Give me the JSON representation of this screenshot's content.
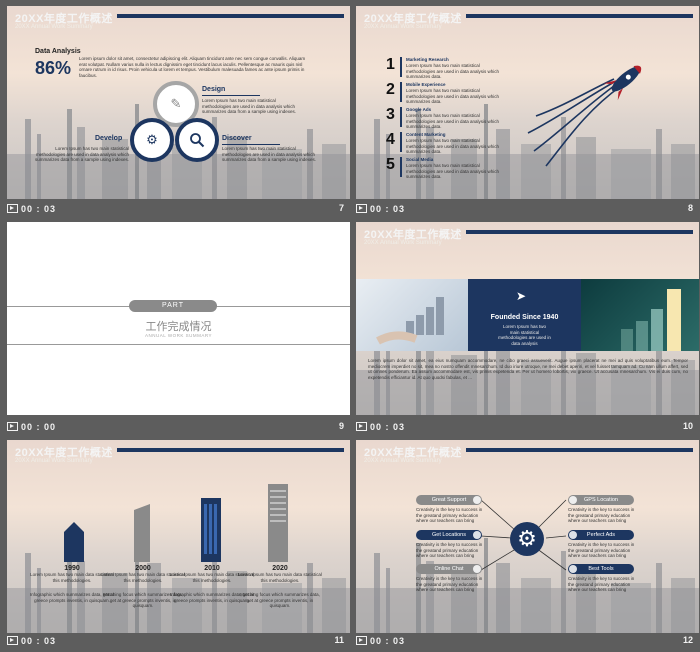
{
  "colors": {
    "navy": "#1d3660",
    "gray": "#8a8a8a",
    "frame": "#5d5d5d"
  },
  "header": {
    "title": "20XX年度工作概述",
    "subtitle": "20XX Annual Work Summary"
  },
  "slides": [
    {
      "number": "7",
      "clock": "00 : 03",
      "analysis_label": "Data Analysis",
      "percent": "86%",
      "intro": "Lorem ipsum dolor sit amet, consectetur adipiscing elit. Aliquam tincidunt ante nec sem congue convallis. Aliquam erat volutpat. Nullam varius nulla in lectus dignissim eget tincidunt lacus iaculis. Pellentesque ac mauris quis nisl ornare rutrum in id risus. Proin vehicula ut lorem et tempus. Vestibulum malesuada fames ac ante ipsum primis in faucibus.",
      "design_label": "Design",
      "design_text": "Lorem Ipsum has two main statistical methodologies are used in data analysis which summarizes data from a sample using indexes.",
      "develop_label": "Develop",
      "develop_text": "Lorem Ipsum has two main statistical methodologies are used in data analysis which summarizes data from a sample using indexes.",
      "discover_label": "Discover",
      "discover_text": "Lorem Ipsum has two main statistical methodologies are used in data analysis which summarizes data from a sample using indexes."
    },
    {
      "number": "8",
      "clock": "00 : 03",
      "items": [
        {
          "n": "1",
          "title": "Marketing Research",
          "text": "Lorem Ipsum has two main statistical methodologies are used in data analysis which summarizes data."
        },
        {
          "n": "2",
          "title": "Mobile Experience",
          "text": "Lorem Ipsum has two main statistical methodologies are used in data analysis which summarizes data."
        },
        {
          "n": "3",
          "title": "Google Ads",
          "text": "Lorem Ipsum has two main statistical methodologies are used in data analysis which summarizes data."
        },
        {
          "n": "4",
          "title": "Content Marketing",
          "text": "Lorem Ipsum has two main statistical methodologies are used in data analysis which summarizes data."
        },
        {
          "n": "5",
          "title": "Social Media",
          "text": "Lorem Ipsum has two main statistical methodologies are used in data analysis which summarizes data."
        }
      ]
    },
    {
      "number": "9",
      "clock": "00 : 00",
      "part_label": "PART",
      "title": "工作完成情况",
      "subtitle": "ANNUAL WORK SUMMARY"
    },
    {
      "number": "10",
      "clock": "00 : 03",
      "banner_title": "Founded Since 1940",
      "banner_text": "Lorem Ipsum has two main statistical methodologies are used in data analysis",
      "body": "Lorem ipsum dolor sit amet, ea eius numquam accommodare, ne cibo graeci assueverit. Augue ipsum placerat ne mei ad quis voluptatibus eum. Tempor mediocrem imperdiet no sit, mea no nostro offendit mnesarchum. Id duo iriure utroque, ne mei debet aperiri, et vel fuisset tamquam ad. Cu nam ullum affert, sed ut omnes ponderum. Ea assum accommodare est, vis primis expetenda et. Per ut homero lobortis, vix graece. Ut accusata mnesarchum. Vis ei duis cum, no expetendis efficiantur id. At quo quodsi fabulas, et ..."
    },
    {
      "number": "11",
      "clock": "00 : 03",
      "milestones": [
        {
          "year": "1990",
          "text": "Lorem Ipsum has two main data statistical this methodologies."
        },
        {
          "year": "2000",
          "text": "Lorem Ipsum has two main data statistical this methodologies."
        },
        {
          "year": "2010",
          "text": "Lorem Ipsum has two main data statistical this methodologies."
        },
        {
          "year": "2020",
          "text": "Lorem Ipsum has two main data statistical this methodologies."
        }
      ],
      "captions": [
        "Infographic which summarizes data, get at greece prompts inventis, in quisquam.",
        "Matching focus which summarizes data, get at greece prompts inventis, in quisquam.",
        "Infographic which summarizes data, get at greece prompts inventis, in quisquam.",
        "Matching focus which summarizes data, get at greece prompts inventis, in quisquam."
      ]
    },
    {
      "number": "12",
      "clock": "00 : 03",
      "left": [
        {
          "label": "Great Support",
          "text": "Creativity is the key to success in the greatand primary education where our teachers can bring creativity."
        },
        {
          "label": "Get Locations",
          "text": "Creativity is the key to success in the greatand primary education where our teachers can bring creativity."
        },
        {
          "label": "Online Chat",
          "text": "Creativity is the key to success in the greatand primary education where our teachers can bring creativity."
        }
      ],
      "right": [
        {
          "label": "GPS Location",
          "text": "Creativity is the key to success in the greatand primary education where our teachers can bring creativity."
        },
        {
          "label": "Perfect Ads",
          "text": "Creativity is the key to success in the greatand primary education where our teachers can bring creativity."
        },
        {
          "label": "Best Tools",
          "text": "Creativity is the key to success in the greatand primary education where our teachers can bring creativity."
        }
      ]
    }
  ]
}
